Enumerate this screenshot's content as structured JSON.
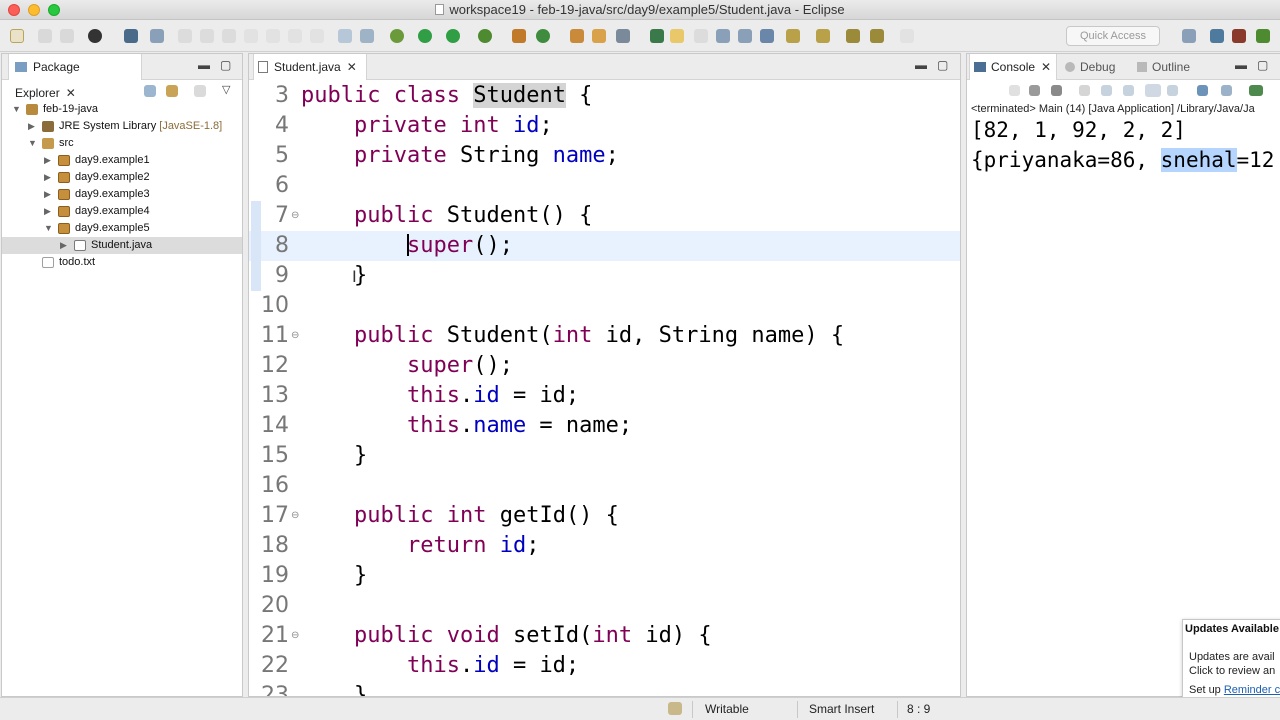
{
  "window": {
    "title": "workspace19 - feb-19-java/src/day9/example5/Student.java - Eclipse"
  },
  "toolbar": {
    "quick_access_placeholder": "Quick Access"
  },
  "package_explorer": {
    "tab_label": "Package Explorer",
    "tree": [
      {
        "label": "feb-19-java",
        "decor": "",
        "icon": "project-icon",
        "depth": 0,
        "expanded": true
      },
      {
        "label": "JRE System Library",
        "decor": " [JavaSE-1.8]",
        "icon": "library-icon",
        "depth": 1,
        "expanded": false
      },
      {
        "label": "src",
        "decor": "",
        "icon": "source-folder-icon",
        "depth": 1,
        "expanded": true
      },
      {
        "label": "day9.example1",
        "decor": "",
        "icon": "package-icon",
        "depth": 2,
        "expanded": false
      },
      {
        "label": "day9.example2",
        "decor": "",
        "icon": "package-icon",
        "depth": 2,
        "expanded": false
      },
      {
        "label": "day9.example3",
        "decor": "",
        "icon": "package-icon",
        "depth": 2,
        "expanded": false
      },
      {
        "label": "day9.example4",
        "decor": "",
        "icon": "package-icon",
        "depth": 2,
        "expanded": false
      },
      {
        "label": "day9.example5",
        "decor": "",
        "icon": "package-icon",
        "depth": 2,
        "expanded": true
      },
      {
        "label": "Student.java",
        "decor": "",
        "icon": "java-file-icon",
        "depth": 3,
        "expanded": false,
        "selected": true
      },
      {
        "label": "todo.txt",
        "decor": "",
        "icon": "text-file-icon",
        "depth": 1,
        "expanded": null
      }
    ]
  },
  "editor": {
    "tab_label": "Student.java",
    "lines": [
      {
        "n": "3",
        "html_parts": [
          [
            "kw",
            "public"
          ],
          [
            "t",
            " "
          ],
          [
            "kw",
            "class"
          ],
          [
            "t",
            " "
          ],
          [
            "hl",
            "Student"
          ],
          [
            "t",
            " {"
          ]
        ]
      },
      {
        "n": "4",
        "html_parts": [
          [
            "t",
            "    "
          ],
          [
            "kw",
            "private"
          ],
          [
            "t",
            " "
          ],
          [
            "kw",
            "int"
          ],
          [
            "t",
            " "
          ],
          [
            "fld",
            "id"
          ],
          [
            "t",
            ";"
          ]
        ]
      },
      {
        "n": "5",
        "html_parts": [
          [
            "t",
            "    "
          ],
          [
            "kw",
            "private"
          ],
          [
            "t",
            " String "
          ],
          [
            "fld",
            "name"
          ],
          [
            "t",
            ";"
          ]
        ]
      },
      {
        "n": "6",
        "html_parts": []
      },
      {
        "n": "7",
        "fold": true,
        "html_parts": [
          [
            "t",
            "    "
          ],
          [
            "kw",
            "public"
          ],
          [
            "t",
            " Student() {"
          ]
        ]
      },
      {
        "n": "8",
        "current": true,
        "html_parts": [
          [
            "t",
            "        "
          ],
          [
            "caret",
            ""
          ],
          [
            "kw",
            "super"
          ],
          [
            "t",
            "();"
          ]
        ]
      },
      {
        "n": "9",
        "html_parts": [
          [
            "t",
            "    }"
          ]
        ]
      },
      {
        "n": "10",
        "html_parts": []
      },
      {
        "n": "11",
        "fold": true,
        "html_parts": [
          [
            "t",
            "    "
          ],
          [
            "kw",
            "public"
          ],
          [
            "t",
            " Student("
          ],
          [
            "kw",
            "int"
          ],
          [
            "t",
            " id, String name) {"
          ]
        ]
      },
      {
        "n": "12",
        "html_parts": [
          [
            "t",
            "        "
          ],
          [
            "kw",
            "super"
          ],
          [
            "t",
            "();"
          ]
        ]
      },
      {
        "n": "13",
        "html_parts": [
          [
            "t",
            "        "
          ],
          [
            "kw",
            "this"
          ],
          [
            "t",
            "."
          ],
          [
            "fld",
            "id"
          ],
          [
            "t",
            " = id;"
          ]
        ]
      },
      {
        "n": "14",
        "html_parts": [
          [
            "t",
            "        "
          ],
          [
            "kw",
            "this"
          ],
          [
            "t",
            "."
          ],
          [
            "fld",
            "name"
          ],
          [
            "t",
            " = name;"
          ]
        ]
      },
      {
        "n": "15",
        "html_parts": [
          [
            "t",
            "    }"
          ]
        ]
      },
      {
        "n": "16",
        "html_parts": []
      },
      {
        "n": "17",
        "fold": true,
        "html_parts": [
          [
            "t",
            "    "
          ],
          [
            "kw",
            "public"
          ],
          [
            "t",
            " "
          ],
          [
            "kw",
            "int"
          ],
          [
            "t",
            " getId() {"
          ]
        ]
      },
      {
        "n": "18",
        "html_parts": [
          [
            "t",
            "        "
          ],
          [
            "kw",
            "return"
          ],
          [
            "t",
            " "
          ],
          [
            "fld",
            "id"
          ],
          [
            "t",
            ";"
          ]
        ]
      },
      {
        "n": "19",
        "html_parts": [
          [
            "t",
            "    }"
          ]
        ]
      },
      {
        "n": "20",
        "html_parts": []
      },
      {
        "n": "21",
        "fold": true,
        "html_parts": [
          [
            "t",
            "    "
          ],
          [
            "kw",
            "public"
          ],
          [
            "t",
            " "
          ],
          [
            "kw",
            "void"
          ],
          [
            "t",
            " setId("
          ],
          [
            "kw",
            "int"
          ],
          [
            "t",
            " id) {"
          ]
        ]
      },
      {
        "n": "22",
        "html_parts": [
          [
            "t",
            "        "
          ],
          [
            "kw",
            "this"
          ],
          [
            "t",
            "."
          ],
          [
            "fld",
            "id"
          ],
          [
            "t",
            " = id;"
          ]
        ]
      },
      {
        "n": "23",
        "html_parts": [
          [
            "t",
            "    }"
          ]
        ]
      }
    ]
  },
  "console": {
    "tab_console": "Console",
    "tab_debug": "Debug",
    "tab_outline": "Outline",
    "status": "<terminated> Main (14) [Java Application] /Library/Java/Ja",
    "output_line1": "[82, 1, 92, 2, 2]",
    "output_line2_pre": "{priyanaka=86, ",
    "output_line2_sel": "snehal",
    "output_line2_post": "=12"
  },
  "notification": {
    "title": "Updates Available",
    "line1": "Updates are avail",
    "line2": "Click to review an",
    "line3_pre": "Set up ",
    "line3_link": "Reminder c"
  },
  "status_bar": {
    "writable": "Writable",
    "insert_mode": "Smart Insert",
    "position": "8 : 9"
  },
  "colors": {
    "keyword": "#7f0055",
    "field": "#0000c0",
    "current_line": "#e8f2fe",
    "selection": "#b5d5ff"
  }
}
